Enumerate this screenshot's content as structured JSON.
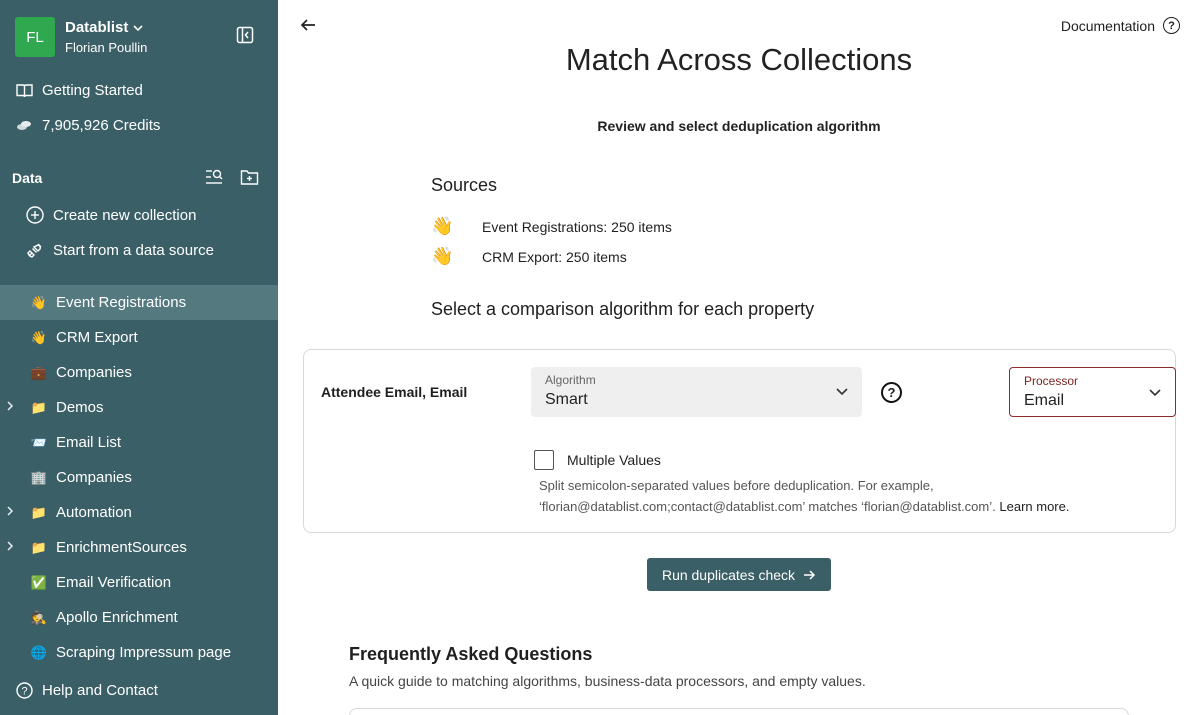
{
  "workspace": {
    "initials": "FL",
    "name": "Datablist",
    "user": "Florian Poullin",
    "avatar_color": "#2fa84f"
  },
  "sidebar": {
    "getting_started": "Getting Started",
    "credits": "7,905,926 Credits",
    "data_title": "Data",
    "create_collection": "Create new collection",
    "start_source": "Start from a data source",
    "collections": [
      {
        "label": "Event Registrations",
        "emoji": "👋",
        "active": true,
        "expandable": false
      },
      {
        "label": "CRM Export",
        "emoji": "👋",
        "active": false,
        "expandable": false
      },
      {
        "label": "Companies",
        "emoji": "💼",
        "active": false,
        "expandable": false
      },
      {
        "label": "Demos",
        "emoji": "📁",
        "active": false,
        "expandable": true
      },
      {
        "label": "Email List",
        "emoji": "📨",
        "active": false,
        "expandable": false
      },
      {
        "label": "Companies",
        "emoji": "🏢",
        "active": false,
        "expandable": false
      },
      {
        "label": "Automation",
        "emoji": "📁",
        "active": false,
        "expandable": true
      },
      {
        "label": "EnrichmentSources",
        "emoji": "📁",
        "active": false,
        "expandable": true
      },
      {
        "label": "Email Verification",
        "emoji": "✅",
        "active": false,
        "expandable": false
      },
      {
        "label": "Apollo Enrichment",
        "emoji": "🕵️",
        "active": false,
        "expandable": false
      },
      {
        "label": "Scraping Impressum page",
        "emoji": "🌐",
        "active": false,
        "expandable": false
      }
    ],
    "help": "Help and Contact",
    "bg_color": "#3a5f66"
  },
  "header": {
    "documentation": "Documentation"
  },
  "main": {
    "title": "Match Across Collections",
    "subtitle": "Review and select deduplication algorithm",
    "sources_title": "Sources",
    "sources": [
      {
        "emoji": "👋",
        "label": "Event Registrations: 250 items"
      },
      {
        "emoji": "👋",
        "label": "CRM Export: 250 items"
      }
    ],
    "comparison_title": "Select a comparison algorithm for each property",
    "property": {
      "name": "Attendee Email, Email",
      "algorithm_label": "Algorithm",
      "algorithm_value": "Smart",
      "processor_label": "Processor",
      "processor_value": "Email",
      "multiple_values_label": "Multiple Values",
      "multiple_values_checked": false,
      "hint": "Split semicolon-separated values before deduplication. For example, ‘florian@datablist.com;contact@datablist.com’ matches ‘florian@datablist.com’.",
      "learn_more": "Learn more."
    },
    "run_button": "Run duplicates check",
    "faq_title": "Frequently Asked Questions",
    "faq_subtitle": "A quick guide to matching algorithms, business-data processors, and empty values."
  }
}
